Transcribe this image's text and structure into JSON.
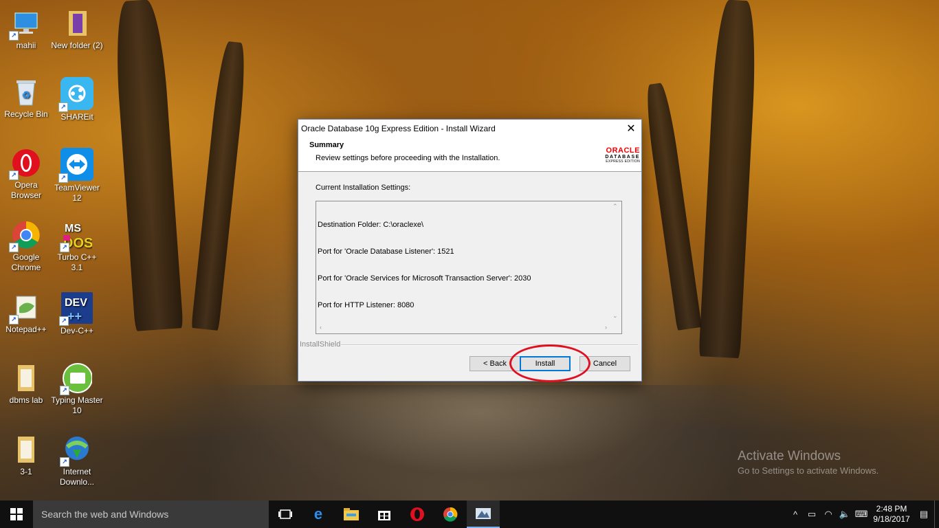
{
  "desktop_icons": [
    {
      "label": "mahii"
    },
    {
      "label": "New folder (2)"
    },
    {
      "label": "Recycle Bin"
    },
    {
      "label": "SHAREit"
    },
    {
      "label": "Opera Browser"
    },
    {
      "label": "TeamViewer 12"
    },
    {
      "label": "Google Chrome"
    },
    {
      "label": "Turbo C++ 3.1"
    },
    {
      "label": "Notepad++"
    },
    {
      "label": "Dev-C++"
    },
    {
      "label": "dbms lab"
    },
    {
      "label": "Typing Master 10"
    },
    {
      "label": "3-1"
    },
    {
      "label": "Internet Downlo..."
    }
  ],
  "dialog": {
    "title": "Oracle Database 10g Express Edition - Install Wizard",
    "close_symbol": "✕",
    "heading": "Summary",
    "subheading": "Review settings before proceeding with the Installation.",
    "logo": {
      "brand": "ORACLE",
      "line2": "DATABASE",
      "line3": "EXPRESS EDITION"
    },
    "settings_label": "Current Installation Settings:",
    "settings_lines": [
      "Destination Folder: C:\\oraclexe\\",
      "Port for 'Oracle Database Listener': 1521",
      "Port for 'Oracle Services for Microsoft Transaction Server': 2030",
      "Port for HTTP Listener: 8080"
    ],
    "installshield_label": "InstallShield",
    "buttons": {
      "back": "< Back",
      "install": "Install",
      "cancel": "Cancel"
    }
  },
  "watermark": {
    "line1": "Activate Windows",
    "line2": "Go to Settings to activate Windows."
  },
  "taskbar": {
    "search_placeholder": "Search the web and Windows",
    "pinned": [
      "task-view",
      "edge",
      "file-explorer",
      "store",
      "opera",
      "chrome",
      "oracle-installer"
    ],
    "clock_time": "2:48 PM",
    "clock_date": "9/18/2017"
  },
  "colors": {
    "accent": "#0078d7",
    "highlight_circle": "#e01020",
    "oracle_red": "#ee0000"
  }
}
